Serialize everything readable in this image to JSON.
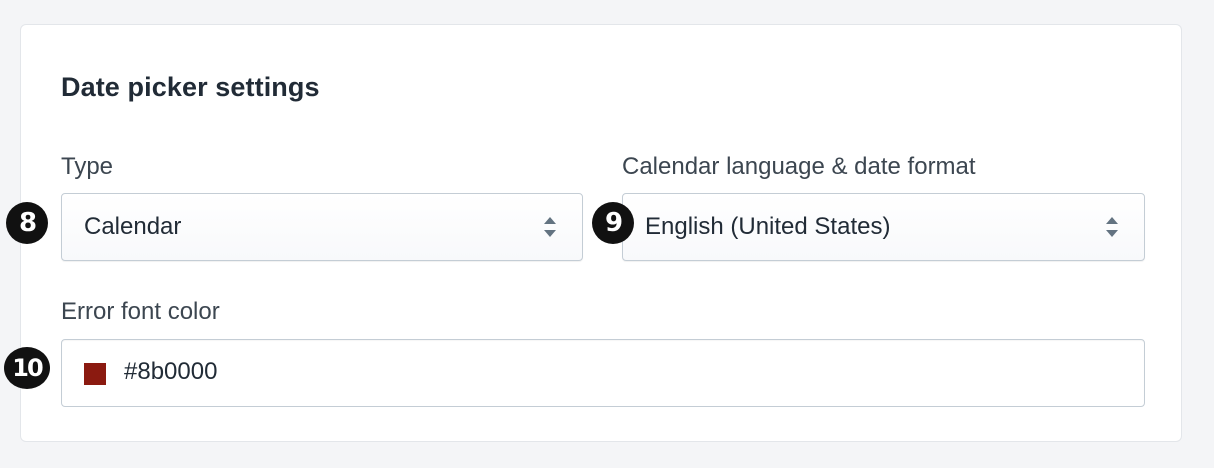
{
  "card": {
    "title": "Date picker settings"
  },
  "fields": {
    "type": {
      "label": "Type",
      "value": "Calendar"
    },
    "language": {
      "label": "Calendar language & date format",
      "value": "English (United States)"
    },
    "error_color": {
      "label": "Error font color",
      "value": "#8b0000",
      "swatch_color": "#8b1a10"
    }
  },
  "markers": {
    "type": "8",
    "language": "9",
    "error_color": "10"
  },
  "icons": {
    "select_arrows": "chevron-up-down-icon"
  }
}
